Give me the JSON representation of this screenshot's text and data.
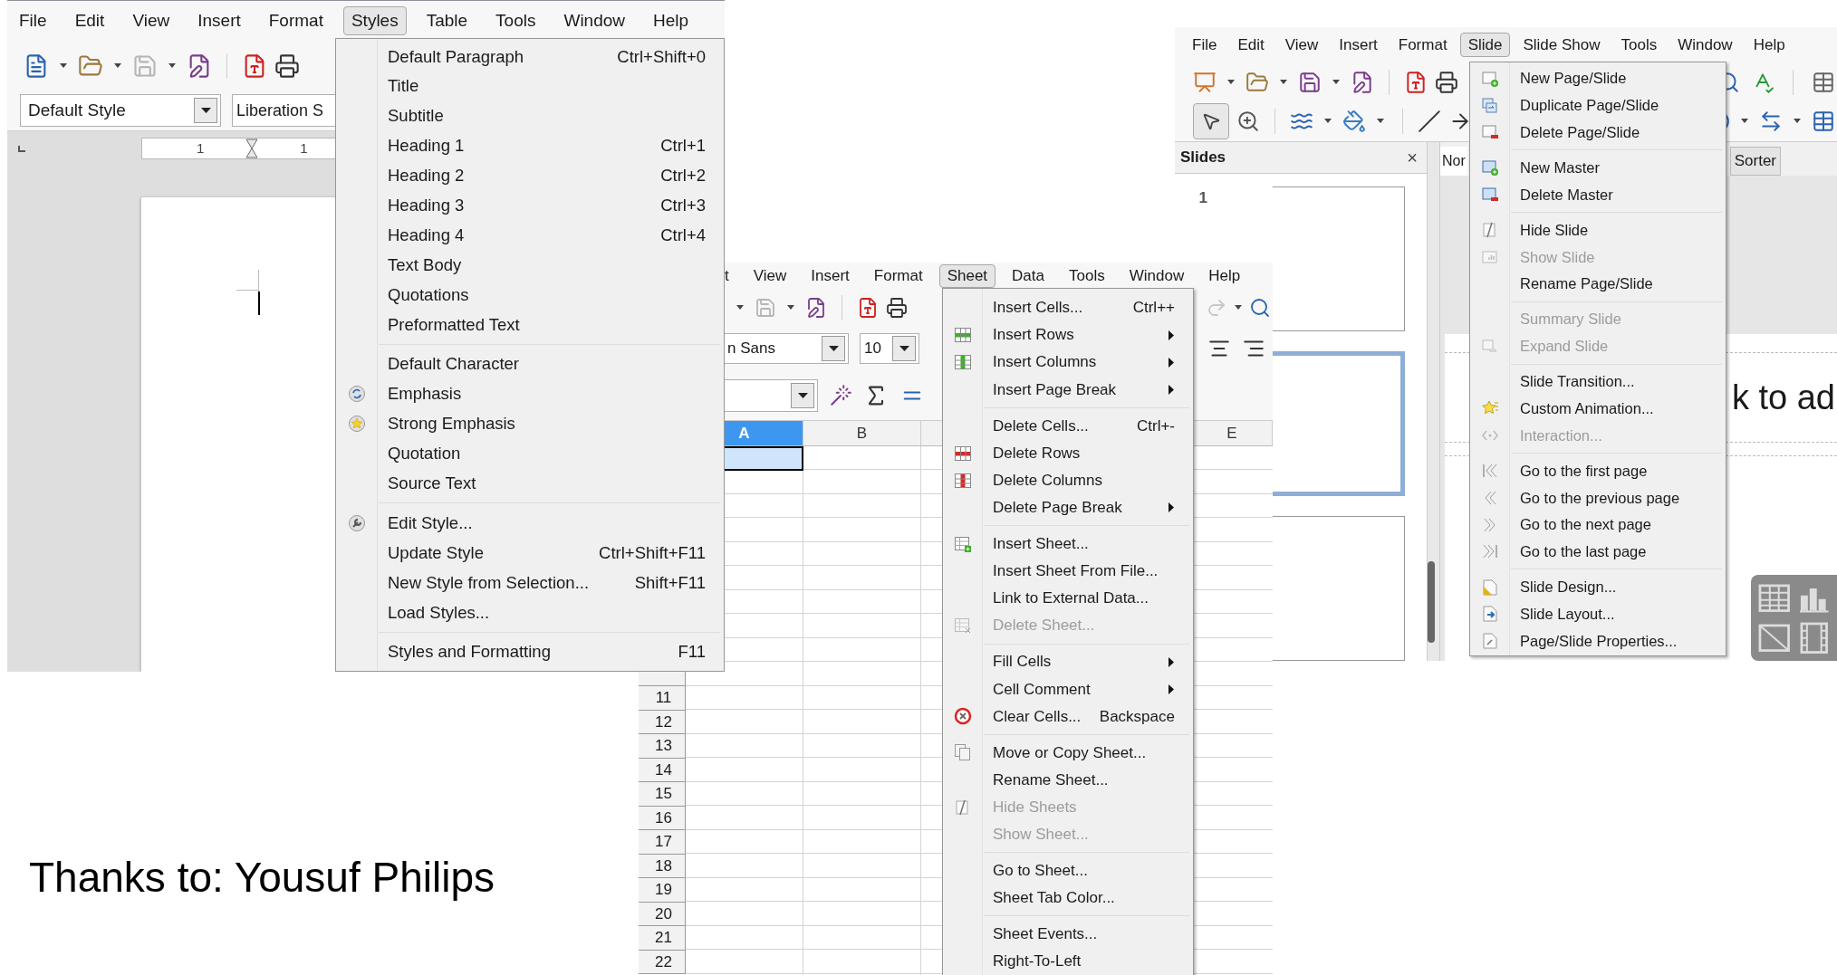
{
  "writer": {
    "menubar": [
      {
        "label": "File",
        "selected": false
      },
      {
        "label": "Edit",
        "selected": false
      },
      {
        "label": "View",
        "selected": false
      },
      {
        "label": "Insert",
        "selected": false
      },
      {
        "label": "Format",
        "selected": false
      },
      {
        "label": "Styles",
        "selected": true
      },
      {
        "label": "Table",
        "selected": false
      },
      {
        "label": "Tools",
        "selected": false
      },
      {
        "label": "Window",
        "selected": false
      },
      {
        "label": "Help",
        "selected": false
      }
    ],
    "paragraph_style": "Default Style",
    "font_name": "Liberation S",
    "ruler_labels": [
      "1",
      "1"
    ],
    "styles_menu": [
      [
        {
          "label": "Default Paragraph",
          "shortcut": "Ctrl+Shift+0"
        },
        {
          "label": "Title"
        },
        {
          "label": "Subtitle"
        },
        {
          "label": "Heading 1",
          "shortcut": "Ctrl+1"
        },
        {
          "label": "Heading 2",
          "shortcut": "Ctrl+2"
        },
        {
          "label": "Heading 3",
          "shortcut": "Ctrl+3"
        },
        {
          "label": "Heading 4",
          "shortcut": "Ctrl+4"
        },
        {
          "label": "Text Body"
        },
        {
          "label": "Quotations"
        },
        {
          "label": "Preformatted Text"
        }
      ],
      [
        {
          "label": "Default Character"
        },
        {
          "label": "Emphasis"
        },
        {
          "label": "Strong Emphasis"
        },
        {
          "label": "Quotation"
        },
        {
          "label": "Source Text"
        }
      ],
      [
        {
          "label": "Edit Style..."
        },
        {
          "label": "Update Style",
          "shortcut": "Ctrl+Shift+F11"
        },
        {
          "label": "New Style from Selection...",
          "shortcut": "Shift+F11"
        },
        {
          "label": "Load Styles..."
        }
      ],
      [
        {
          "label": "Styles and Formatting",
          "shortcut": "F11"
        }
      ]
    ]
  },
  "calc": {
    "menubar": [
      {
        "label": "t",
        "selected": false
      },
      {
        "label": "View",
        "selected": false
      },
      {
        "label": "Insert",
        "selected": false
      },
      {
        "label": "Format",
        "selected": false
      },
      {
        "label": "Sheet",
        "selected": true
      },
      {
        "label": "Data",
        "selected": false
      },
      {
        "label": "Tools",
        "selected": false
      },
      {
        "label": "Window",
        "selected": false
      },
      {
        "label": "Help",
        "selected": false
      }
    ],
    "font_name": "n Sans",
    "font_size": "10",
    "columns": [
      {
        "label": "A",
        "selected": true
      },
      {
        "label": "B",
        "selected": false
      },
      {
        "label": "E",
        "selected": false
      }
    ],
    "row_labels": [
      "11",
      "12",
      "13",
      "14",
      "15",
      "16",
      "17",
      "18",
      "19",
      "20",
      "21",
      "22"
    ],
    "sheet_menu": [
      [
        {
          "label": "Insert Cells...",
          "shortcut": "Ctrl++",
          "submenu": false,
          "disabled": false
        },
        {
          "label": "Insert Rows",
          "submenu": true,
          "disabled": false
        },
        {
          "label": "Insert Columns",
          "submenu": true,
          "disabled": false
        },
        {
          "label": "Insert Page Break",
          "submenu": true,
          "disabled": false
        }
      ],
      [
        {
          "label": "Delete Cells...",
          "shortcut": "Ctrl+-",
          "submenu": false,
          "disabled": false
        },
        {
          "label": "Delete Rows",
          "submenu": false,
          "disabled": false
        },
        {
          "label": "Delete Columns",
          "submenu": false,
          "disabled": false
        },
        {
          "label": "Delete Page Break",
          "submenu": true,
          "disabled": false
        }
      ],
      [
        {
          "label": "Insert Sheet...",
          "submenu": false,
          "disabled": false
        },
        {
          "label": "Insert Sheet From File...",
          "submenu": false,
          "disabled": false
        },
        {
          "label": "Link to External Data...",
          "submenu": false,
          "disabled": false
        },
        {
          "label": "Delete Sheet...",
          "submenu": false,
          "disabled": true
        }
      ],
      [
        {
          "label": "Fill Cells",
          "submenu": true,
          "disabled": false
        },
        {
          "label": "Cell Comment",
          "submenu": true,
          "disabled": false
        },
        {
          "label": "Clear Cells...",
          "shortcut": "Backspace",
          "submenu": false,
          "disabled": false
        }
      ],
      [
        {
          "label": "Move or Copy Sheet...",
          "submenu": false,
          "disabled": false
        },
        {
          "label": "Rename Sheet...",
          "submenu": false,
          "disabled": false
        },
        {
          "label": "Hide Sheets",
          "submenu": false,
          "disabled": true
        },
        {
          "label": "Show Sheet...",
          "submenu": false,
          "disabled": true
        }
      ],
      [
        {
          "label": "Go to Sheet...",
          "submenu": false,
          "disabled": false
        },
        {
          "label": "Sheet Tab Color...",
          "submenu": false,
          "disabled": false
        }
      ],
      [
        {
          "label": "Sheet Events...",
          "submenu": false,
          "disabled": false
        },
        {
          "label": "Right-To-Left",
          "submenu": false,
          "disabled": false
        }
      ]
    ]
  },
  "impress": {
    "menubar": [
      {
        "label": "File",
        "selected": false
      },
      {
        "label": "Edit",
        "selected": false
      },
      {
        "label": "View",
        "selected": false
      },
      {
        "label": "Insert",
        "selected": false
      },
      {
        "label": "Format",
        "selected": false
      },
      {
        "label": "Slide",
        "selected": true
      },
      {
        "label": "Slide Show",
        "selected": false
      },
      {
        "label": "Tools",
        "selected": false
      },
      {
        "label": "Window",
        "selected": false
      },
      {
        "label": "Help",
        "selected": false
      }
    ],
    "slides_panel": {
      "title": "Slides",
      "close": "×",
      "thumbnails": [
        {
          "number": "1",
          "selected": false
        },
        {
          "selected": true
        },
        {
          "selected": false
        }
      ]
    },
    "view_tabs": [
      "Nor",
      "Sorter"
    ],
    "title_placeholder": "k to ad",
    "slide_menu": [
      [
        {
          "label": "New Page/Slide",
          "disabled": false
        },
        {
          "label": "Duplicate Page/Slide",
          "disabled": false
        },
        {
          "label": "Delete Page/Slide",
          "disabled": false
        }
      ],
      [
        {
          "label": "New Master",
          "disabled": false
        },
        {
          "label": "Delete Master",
          "disabled": false
        }
      ],
      [
        {
          "label": "Hide Slide",
          "disabled": false
        },
        {
          "label": "Show Slide",
          "disabled": true
        },
        {
          "label": "Rename Page/Slide",
          "disabled": false
        }
      ],
      [
        {
          "label": "Summary Slide",
          "disabled": true
        },
        {
          "label": "Expand Slide",
          "disabled": true
        }
      ],
      [
        {
          "label": "Slide Transition...",
          "disabled": false
        },
        {
          "label": "Custom Animation...",
          "disabled": false
        },
        {
          "label": "Interaction...",
          "disabled": true
        }
      ],
      [
        {
          "label": "Go to the first page",
          "disabled": false
        },
        {
          "label": "Go to the previous page",
          "disabled": false
        },
        {
          "label": "Go to the next page",
          "disabled": false
        },
        {
          "label": "Go to the last page",
          "disabled": false
        }
      ],
      [
        {
          "label": "Slide Design...",
          "disabled": false
        },
        {
          "label": "Slide Layout...",
          "disabled": false
        },
        {
          "label": "Page/Slide Properties...",
          "disabled": false
        }
      ]
    ]
  },
  "credit": "Thanks to: Yousuf Philips"
}
